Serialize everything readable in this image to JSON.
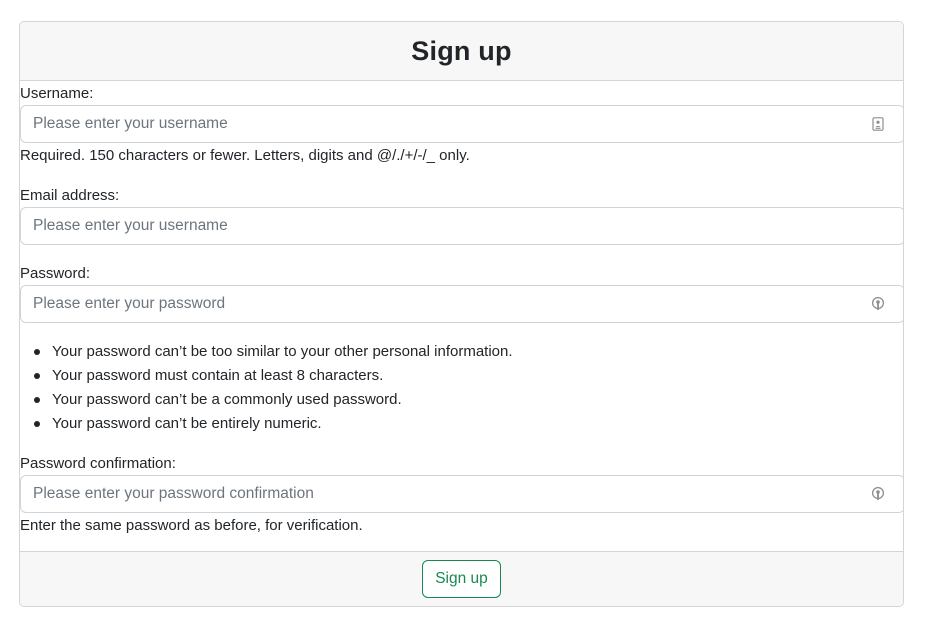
{
  "header": {
    "title": "Sign up"
  },
  "username": {
    "label": "Username:",
    "placeholder": "Please enter your username",
    "value": "",
    "icon": "contact-card-icon",
    "help": "Required. 150 characters or fewer. Letters, digits and @/./+/-/_ only."
  },
  "email": {
    "label": "Email address:",
    "placeholder": "Please enter your username",
    "value": ""
  },
  "password": {
    "label": "Password:",
    "placeholder": "Please enter your password",
    "value": "",
    "icon": "password-manager-key-icon",
    "rules": [
      "Your password can’t be too similar to your other personal information.",
      "Your password must contain at least 8 characters.",
      "Your password can’t be a commonly used password.",
      "Your password can’t be entirely numeric."
    ]
  },
  "password_confirmation": {
    "label": "Password confirmation:",
    "placeholder": "Please enter your password confirmation",
    "value": "",
    "icon": "password-manager-key-icon",
    "help": "Enter the same password as before, for verification."
  },
  "footer": {
    "submit_label": "Sign up"
  },
  "colors": {
    "accent": "#198754",
    "header_bg": "#f7f7f7",
    "border": "#d5d5d5",
    "placeholder": "#6c757d"
  }
}
